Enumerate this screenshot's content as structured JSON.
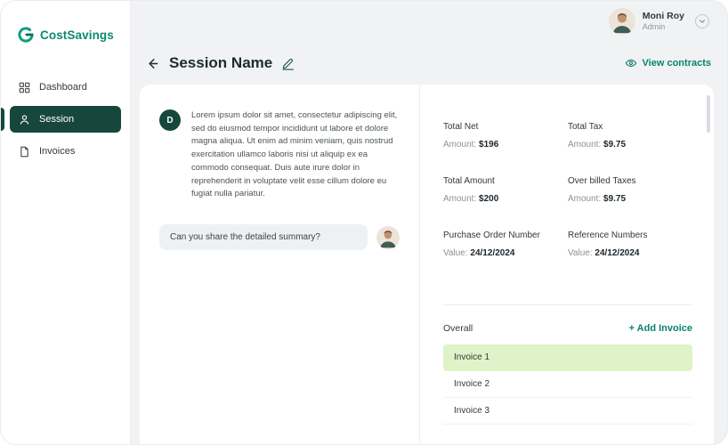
{
  "sidebar": {
    "logo_text": "CostSavings",
    "items": [
      {
        "label": "Dashboard",
        "active": false
      },
      {
        "label": "Session",
        "active": true
      },
      {
        "label": "Invoices",
        "active": false
      }
    ]
  },
  "header": {
    "user": {
      "name": "Moni Roy",
      "role": "Admin"
    }
  },
  "page": {
    "title": "Session Name",
    "view_contracts_label": "View contracts"
  },
  "chat": {
    "avatar_letter": "D",
    "message": "Lorem ipsum dolor sit amet, consectetur adipiscing elit, sed do eiusmod tempor incididunt ut labore et dolore magna aliqua. Ut enim ad minim veniam, quis nostrud exercitation ullamco laboris nisi ut aliquip ex ea commodo consequat. Duis aute irure dolor in reprehenderit in voluptate velit esse cillum dolore eu fugiat nulla pariatur.",
    "question": "Can you share the detailed summary?"
  },
  "summary": {
    "fields": [
      {
        "label": "Total Net",
        "prefix": "Amount:",
        "value": "$196"
      },
      {
        "label": "Total Tax",
        "prefix": "Amount:",
        "value": "$9.75"
      },
      {
        "label": "Total Amount",
        "prefix": "Amount:",
        "value": "$200"
      },
      {
        "label": "Over billed Taxes",
        "prefix": "Amount:",
        "value": "$9.75"
      },
      {
        "label": "Purchase Order Number",
        "prefix": "Value:",
        "value": "24/12/2024"
      },
      {
        "label": "Reference Numbers",
        "prefix": "Value:",
        "value": "24/12/2024"
      }
    ]
  },
  "invoices": {
    "overall_label": "Overall",
    "add_invoice_label": "+ Add Invoice",
    "items": [
      {
        "label": "Invoice 1",
        "selected": true
      },
      {
        "label": "Invoice 2",
        "selected": false
      },
      {
        "label": "Invoice 3",
        "selected": false
      }
    ]
  },
  "colors": {
    "brand_green": "#0c8a6e",
    "active_dark_green": "#17473c",
    "link_teal": "#0a8270",
    "selected_invoice_bg": "#def3c8"
  }
}
